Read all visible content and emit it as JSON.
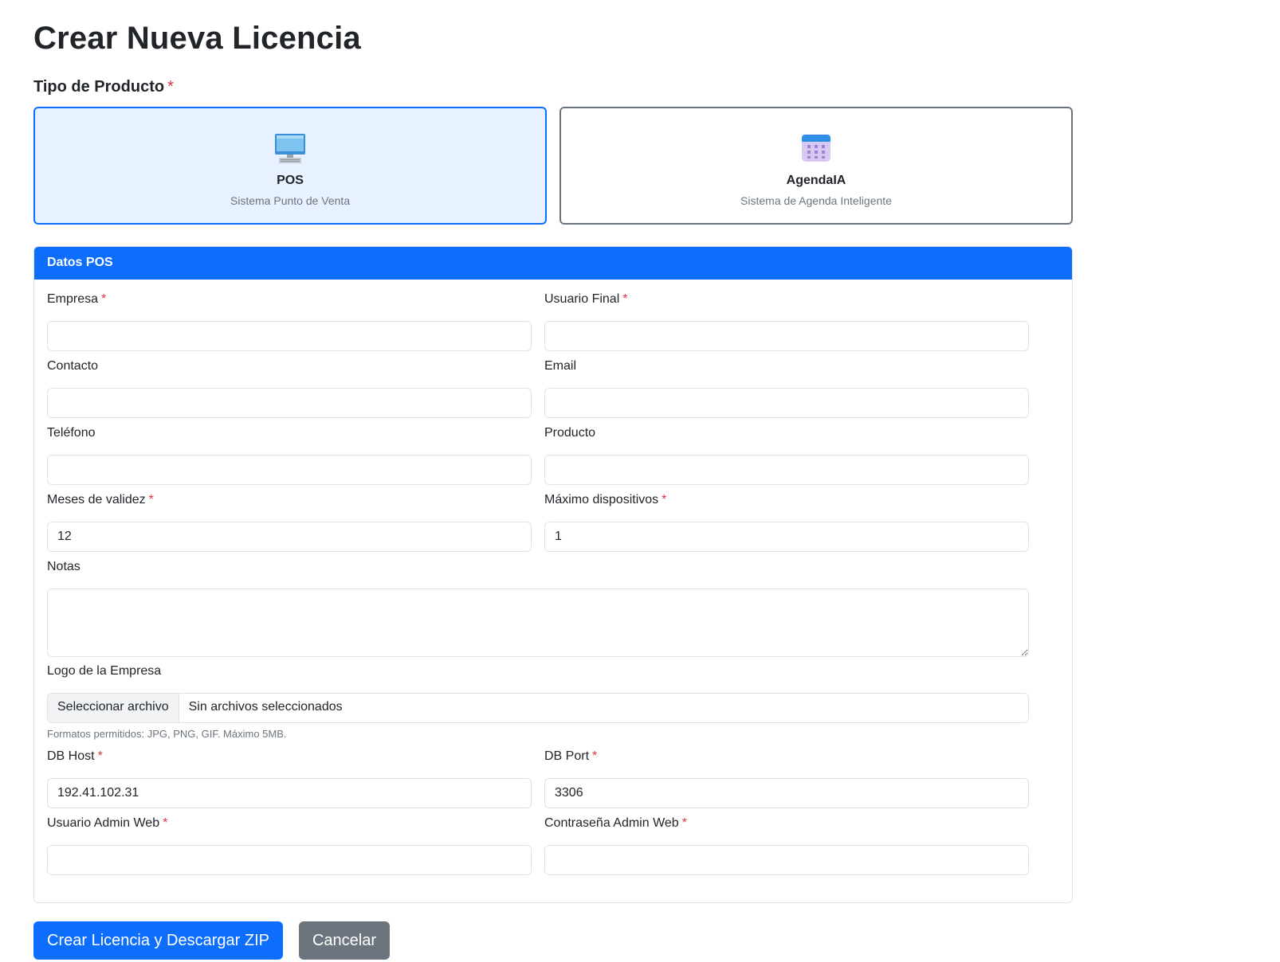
{
  "page": {
    "title": "Crear Nueva Licencia"
  },
  "product_type": {
    "label": "Tipo de Producto",
    "required_mark": "*",
    "options": [
      {
        "name": "POS",
        "description": "Sistema Punto de Venta",
        "icon": "computer-icon",
        "selected": true
      },
      {
        "name": "AgendaIA",
        "description": "Sistema de Agenda Inteligente",
        "icon": "calendar-icon",
        "selected": false
      }
    ]
  },
  "form": {
    "header": "Datos POS",
    "required_mark": "*",
    "fields": {
      "empresa": {
        "label": "Empresa",
        "value": ""
      },
      "usuario_final": {
        "label": "Usuario Final",
        "value": ""
      },
      "contacto": {
        "label": "Contacto",
        "value": ""
      },
      "email": {
        "label": "Email",
        "value": ""
      },
      "telefono": {
        "label": "Teléfono",
        "value": ""
      },
      "producto": {
        "label": "Producto",
        "value": ""
      },
      "meses_validez": {
        "label": "Meses de validez",
        "value": "12"
      },
      "max_dispositivos": {
        "label": "Máximo dispositivos",
        "value": "1"
      },
      "notas": {
        "label": "Notas",
        "value": ""
      },
      "logo": {
        "label": "Logo de la Empresa",
        "button": "Seleccionar archivo",
        "status": "Sin archivos seleccionados",
        "help": "Formatos permitidos: JPG, PNG, GIF. Máximo 5MB."
      },
      "db_host": {
        "label": "DB Host",
        "value": "192.41.102.31"
      },
      "db_port": {
        "label": "DB Port",
        "value": "3306"
      },
      "usuario_admin_web": {
        "label": "Usuario Admin Web",
        "value": ""
      },
      "contrasena_admin_web": {
        "label": "Contraseña Admin Web",
        "value": ""
      }
    }
  },
  "actions": {
    "submit": "Crear Licencia y Descargar ZIP",
    "cancel": "Cancelar"
  },
  "colors": {
    "primary": "#0d6efd",
    "secondary": "#6c757d",
    "required": "#dc3545",
    "selected_bg": "#e7f1ff"
  }
}
